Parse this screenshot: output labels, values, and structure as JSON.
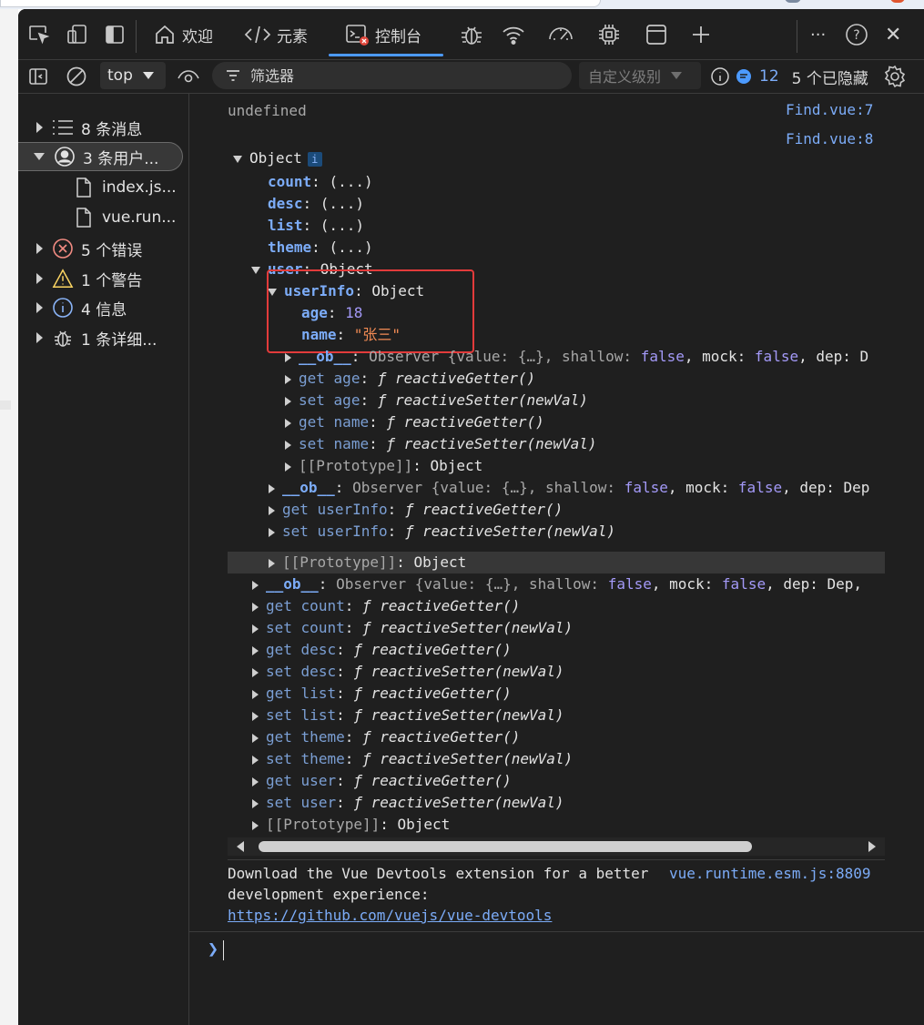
{
  "toolbar": {
    "tabs": [
      {
        "label": "欢迎",
        "icon": "home-icon"
      },
      {
        "label": "元素",
        "icon": "code-icon"
      },
      {
        "label": "控制台",
        "icon": "console-icon"
      }
    ],
    "more_label": "···",
    "help_label": "?",
    "close_label": "✕"
  },
  "console_toolbar": {
    "context": "top",
    "filter_placeholder": "筛选器",
    "levels_label": "自定义级别",
    "issues_count": "12",
    "hidden_label": "5 个已隐藏"
  },
  "sidebar": {
    "items": [
      {
        "label": "8 条消息",
        "icon": "list-icon"
      },
      {
        "label": "3 条用户...",
        "icon": "user-icon"
      },
      {
        "label": "index.js...",
        "icon": "file-icon"
      },
      {
        "label": "vue.run...",
        "icon": "file-icon"
      },
      {
        "label": "5 个错误",
        "icon": "error-icon"
      },
      {
        "label": "1 个警告",
        "icon": "warning-icon"
      },
      {
        "label": "4 信息",
        "icon": "info-icon"
      },
      {
        "label": "1 条详细...",
        "icon": "bug-icon"
      }
    ]
  },
  "console": {
    "line_undefined": "undefined",
    "src1": "Find.vue:7",
    "src2": "Find.vue:8",
    "object_label": "Object",
    "info_badge": "i",
    "props": [
      {
        "key": "count",
        "val": "(...)"
      },
      {
        "key": "desc",
        "val": "(...)"
      },
      {
        "key": "list",
        "val": "(...)"
      },
      {
        "key": "theme",
        "val": "(...)"
      }
    ],
    "user_key": "user",
    "userinfo_key": "userInfo",
    "age_key": "age",
    "age_val": "18",
    "name_key": "name",
    "name_val": "\"张三\"",
    "ob_key": "__ob__",
    "observer_prefix": "Observer {value: {…}, shallow: ",
    "false_val": "false",
    "mock_text": ", mock: ",
    "dep_text": ", dep: ",
    "dep_tail_1": "D",
    "dep_tail_2": "Dep",
    "dep_tail_3": "Dep,",
    "inner_accessors": [
      {
        "kind": "get",
        "name": "age",
        "fn": "reactiveGetter()"
      },
      {
        "kind": "set",
        "name": "age",
        "fn": "reactiveSetter(newVal)"
      },
      {
        "kind": "get",
        "name": "name",
        "fn": "reactiveGetter()"
      },
      {
        "kind": "set",
        "name": "name",
        "fn": "reactiveSetter(newVal)"
      }
    ],
    "prototype_key": "[[Prototype]]",
    "mid_accessors": [
      {
        "kind": "get",
        "name": "userInfo",
        "fn": "reactiveGetter()"
      },
      {
        "kind": "set",
        "name": "userInfo",
        "fn": "reactiveSetter(newVal)"
      }
    ],
    "outer_accessors": [
      {
        "kind": "get",
        "name": "count",
        "fn": "reactiveGetter()"
      },
      {
        "kind": "set",
        "name": "count",
        "fn": "reactiveSetter(newVal)"
      },
      {
        "kind": "get",
        "name": "desc",
        "fn": "reactiveGetter()"
      },
      {
        "kind": "set",
        "name": "desc",
        "fn": "reactiveSetter(newVal)"
      },
      {
        "kind": "get",
        "name": "list",
        "fn": "reactiveGetter()"
      },
      {
        "kind": "set",
        "name": "list",
        "fn": "reactiveSetter(newVal)"
      },
      {
        "kind": "get",
        "name": "theme",
        "fn": "reactiveGetter()"
      },
      {
        "kind": "set",
        "name": "theme",
        "fn": "reactiveSetter(newVal)"
      },
      {
        "kind": "get",
        "name": "user",
        "fn": "reactiveGetter()"
      },
      {
        "kind": "set",
        "name": "user",
        "fn": "reactiveSetter(newVal)"
      }
    ],
    "devtools_msg_1": "Download the Vue Devtools extension for a better",
    "devtools_src": "vue.runtime.esm.js:8809",
    "devtools_msg_2": "development experience:",
    "devtools_link": "https://github.com/vuejs/vue-devtools",
    "prompt": "❯"
  }
}
